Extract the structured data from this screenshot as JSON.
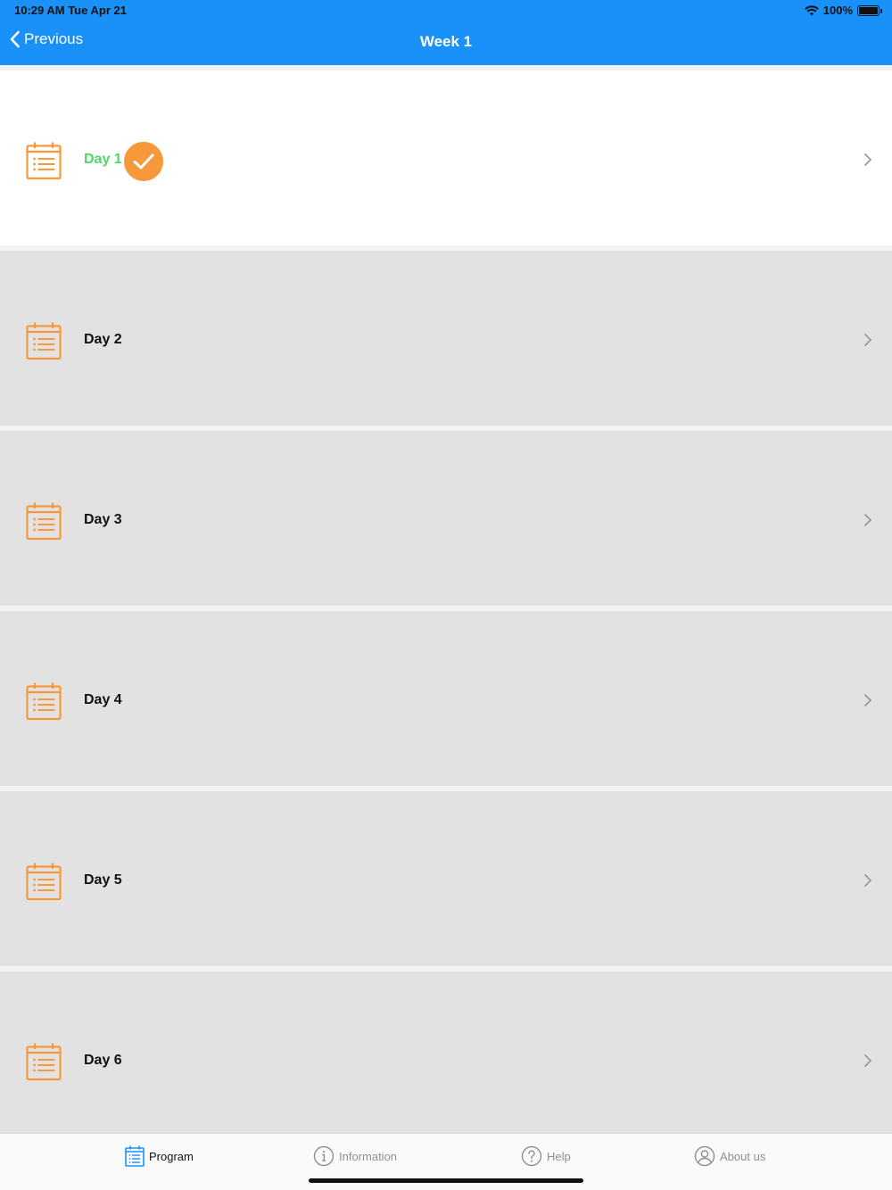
{
  "status_bar": {
    "time": "10:29 AM   Tue Apr 21",
    "battery": "100%"
  },
  "nav": {
    "back_label": "Previous",
    "title": "Week 1"
  },
  "days": [
    {
      "label": "Day 1",
      "completed": true
    },
    {
      "label": "Day 2",
      "completed": false
    },
    {
      "label": "Day 3",
      "completed": false
    },
    {
      "label": "Day 4",
      "completed": false
    },
    {
      "label": "Day 5",
      "completed": false
    },
    {
      "label": "Day 6",
      "completed": false
    }
  ],
  "tabs": [
    {
      "label": "Program",
      "icon": "calendar-list-icon",
      "active": true
    },
    {
      "label": "Information",
      "icon": "info-icon",
      "active": false
    },
    {
      "label": "Help",
      "icon": "question-icon",
      "active": false
    },
    {
      "label": "About us",
      "icon": "person-icon",
      "active": false
    }
  ],
  "colors": {
    "header": "#1a91f8",
    "accent_orange": "#f7993b",
    "completed_green": "#4cd964",
    "row_gray": "#e2e2e2",
    "active_tab_icon": "#1a91f8"
  }
}
